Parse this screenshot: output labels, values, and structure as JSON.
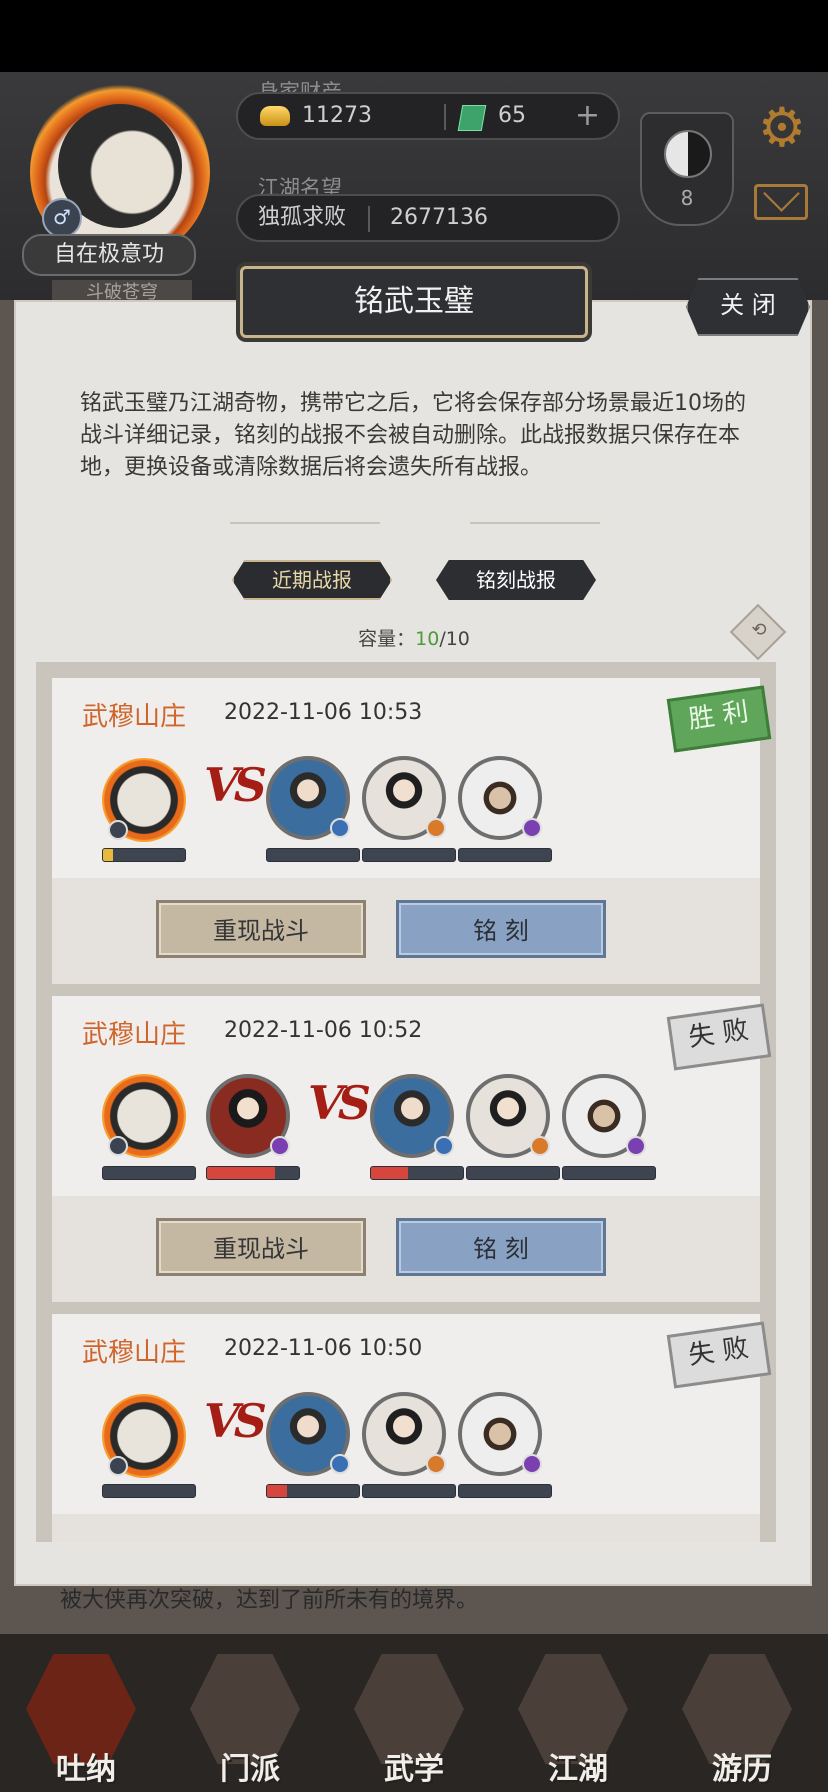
{
  "hud": {
    "wealth_label": "身家财产",
    "gold": "11273",
    "jade": "65",
    "fame_label": "江湖名望",
    "fame_title": "独孤求败",
    "fame_value": "2677136",
    "player_title": "自在极意功",
    "player_subtitle": "斗破苍穹",
    "taiji_level": "8",
    "plus_label": "+",
    "gender_symbol": "♂",
    "gear_symbol": "⚙"
  },
  "background": {
    "story_line_1": "被大侠再次突破，达到了前所未有的境界。"
  },
  "modal": {
    "title": "铭武玉璧",
    "close_label": "关 闭",
    "description": "铭武玉璧乃江湖奇物，携带它之后，它将会保存部分场景最近10场的战斗详细记录，铭刻的战报不会被自动删除。此战报数据只保存在本地，更换设备或清除数据后将会遗失所有战报。",
    "tabs": [
      {
        "label": "近期战报",
        "active": true
      },
      {
        "label": "铭刻战报",
        "active": false
      }
    ],
    "capacity_label": "容量：",
    "capacity_used": "10",
    "capacity_total": "/10",
    "refresh_symbol": "⟲"
  },
  "battles": [
    {
      "location": "武穆山庄",
      "time": "2022-11-06 10:53",
      "result": "胜 利",
      "result_type": "win",
      "vs": "VS",
      "replay_label": "重现战斗",
      "engrave_label": "铭 刻"
    },
    {
      "location": "武穆山庄",
      "time": "2022-11-06 10:52",
      "result": "失 败",
      "result_type": "lose",
      "vs": "VS",
      "replay_label": "重现战斗",
      "engrave_label": "铭 刻"
    },
    {
      "location": "武穆山庄",
      "time": "2022-11-06 10:50",
      "result": "失 败",
      "result_type": "lose",
      "vs": "VS",
      "replay_label": "重现战斗",
      "engrave_label": "铭 刻"
    }
  ],
  "nav": [
    {
      "label": "吐纳",
      "active": true
    },
    {
      "label": "门派",
      "active": false
    },
    {
      "label": "武学",
      "active": false
    },
    {
      "label": "江湖",
      "active": false
    },
    {
      "label": "游历",
      "active": false
    }
  ],
  "colors": {
    "location": "#d0652b",
    "win_stamp": "#5fa55a",
    "hp_red": "#d6463c",
    "hp_yellow": "#e8b93a",
    "accent_gold": "#c9b58c"
  }
}
